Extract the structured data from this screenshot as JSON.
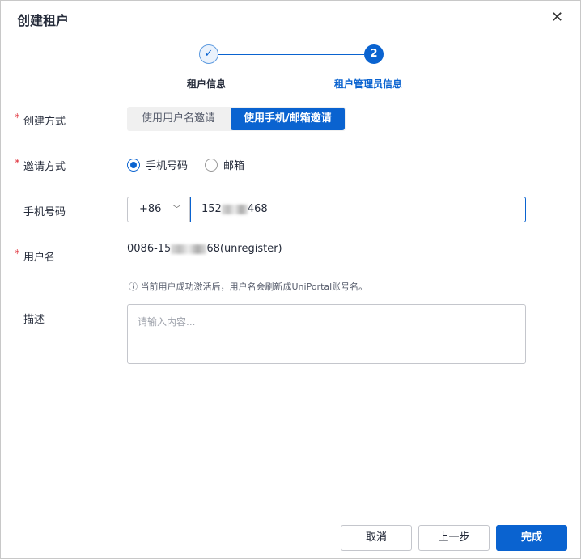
{
  "dialog": {
    "title": "创建租户",
    "close": "✕"
  },
  "steps": [
    {
      "label": "租户信息",
      "icon": "✓"
    },
    {
      "label": "租户管理员信息",
      "number": "2"
    }
  ],
  "form": {
    "create_method": {
      "label": "创建方式",
      "options": [
        "使用用户名邀请",
        "使用手机/邮箱邀请"
      ],
      "selected": "使用手机/邮箱邀请"
    },
    "invite_method": {
      "label": "邀请方式",
      "options": [
        "手机号码",
        "邮箱"
      ],
      "selected": "手机号码"
    },
    "phone": {
      "label": "手机号码",
      "country_code": "+86",
      "value_prefix": "152",
      "value_suffix": "468"
    },
    "username": {
      "label": "用户名",
      "value_prefix": "0086-15",
      "value_suffix": "68(unregister)",
      "hint": "当前用户成功激活后，用户名会刷新成UniPortal账号名。"
    },
    "description": {
      "label": "描述",
      "placeholder": "请输入内容..."
    }
  },
  "footer": {
    "cancel": "取消",
    "prev": "上一步",
    "finish": "完成"
  }
}
